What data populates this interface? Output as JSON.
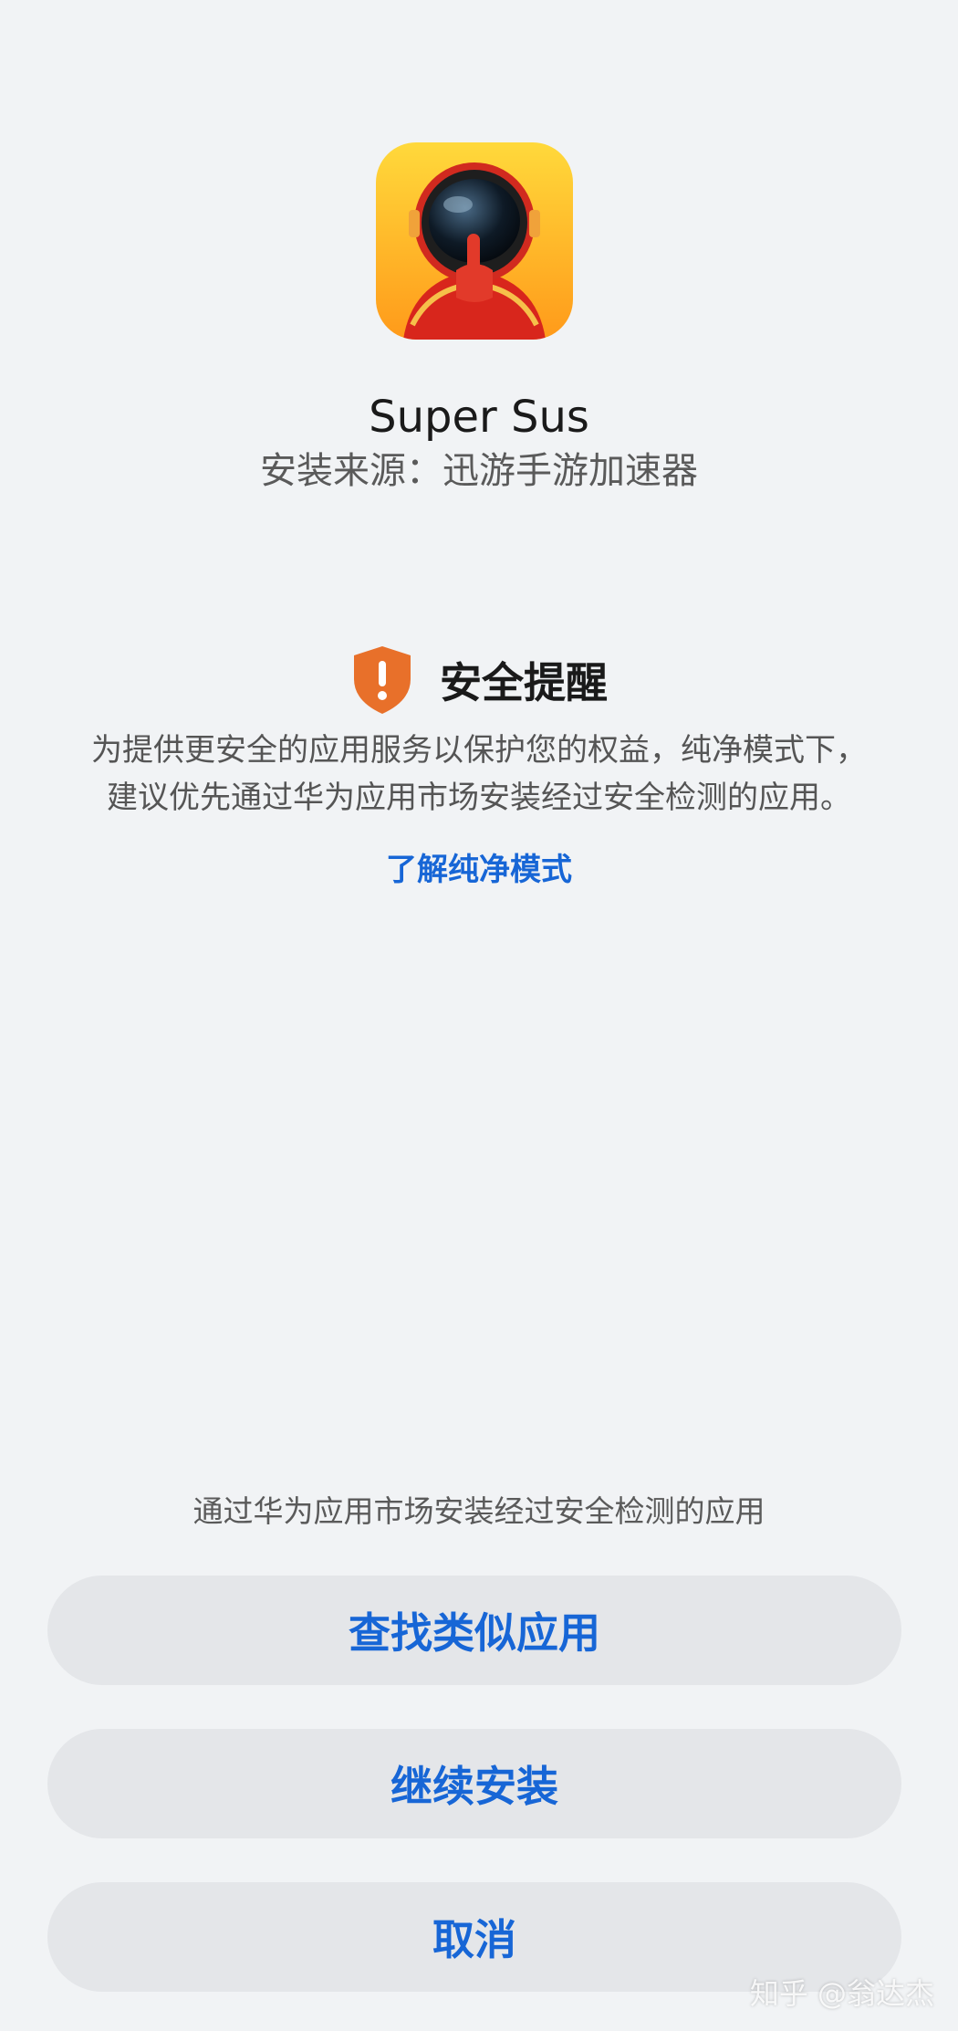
{
  "app": {
    "name": "Super Sus",
    "install_source": "安装来源：迅游手游加速器"
  },
  "warning": {
    "title": "安全提醒",
    "body_line1": "为提供更安全的应用服务以保护您的权益，纯净模式下，",
    "body_line2": "建议优先通过华为应用市场安装经过安全检测的应用。",
    "learn_more_link": "了解纯净模式",
    "icon": "shield-exclamation-icon",
    "icon_color": "#e8702a"
  },
  "actions": {
    "hint": "通过华为应用市场安装经过安全检测的应用",
    "find_similar_label": "查找类似应用",
    "continue_install_label": "继续安装",
    "cancel_label": "取消"
  },
  "watermark": "知乎 @翁达杰",
  "colors": {
    "background": "#f1f3f5",
    "accent": "#1766d6",
    "button_bg": "#e4e6e9"
  }
}
